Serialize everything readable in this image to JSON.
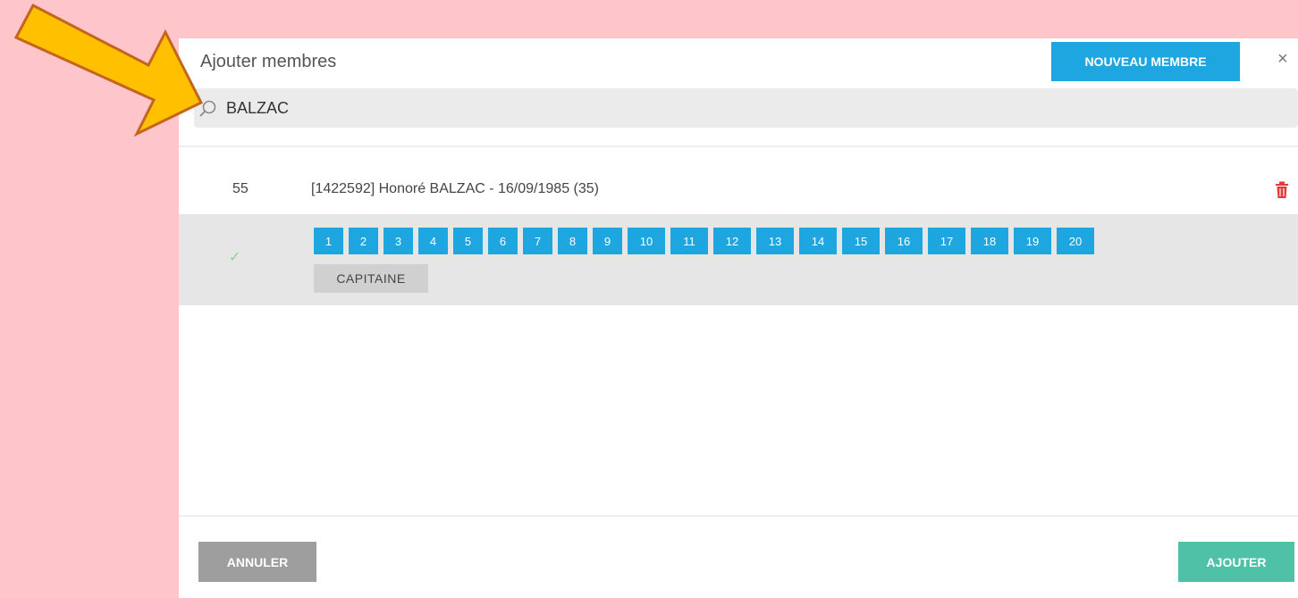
{
  "dialog": {
    "title": "Ajouter membres",
    "new_member_label": "NOUVEAU MEMBRE",
    "close_label": "×"
  },
  "search": {
    "value": "BALZAC",
    "icon": "search-icon"
  },
  "member": {
    "number": "55",
    "label": "[1422592] Honoré BALZAC - 16/09/1985 (35)",
    "delete_icon": "trash-icon",
    "selected_icon": "check-icon",
    "selected_mark": "✓",
    "number_options": [
      "1",
      "2",
      "3",
      "4",
      "5",
      "6",
      "7",
      "8",
      "9",
      "10",
      "11",
      "12",
      "13",
      "14",
      "15",
      "16",
      "17",
      "18",
      "19",
      "20"
    ],
    "captain_label": "CAPITAINE"
  },
  "footer": {
    "cancel_label": "ANNULER",
    "add_label": "AJOUTER"
  },
  "colors": {
    "page_background": "#fec6cb",
    "primary": "#1ea6e0",
    "success": "#4fc1a6",
    "cancel": "#9e9e9e",
    "delete": "#e53935",
    "arrow_fill": "#ffc000",
    "arrow_stroke": "#c5651d"
  }
}
